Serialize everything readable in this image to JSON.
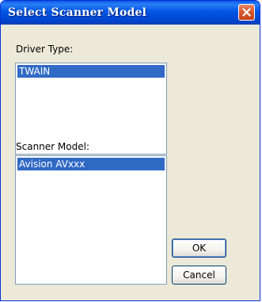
{
  "window": {
    "title": "Select Scanner Model"
  },
  "driver_type": {
    "label": "Driver Type:",
    "items": [
      "TWAIN"
    ],
    "selected": "TWAIN"
  },
  "scanner_model": {
    "label": "Scanner Model:",
    "items": [
      "Avision AVxxx"
    ],
    "selected": "Avision AVxxx"
  },
  "buttons": {
    "ok": "OK",
    "cancel": "Cancel"
  },
  "icons": {
    "close": "close-icon"
  },
  "colors": {
    "titlebar": "#0055e5",
    "selection": "#316ac5",
    "close": "#d8582e",
    "dialog_bg": "#ece9d8"
  }
}
